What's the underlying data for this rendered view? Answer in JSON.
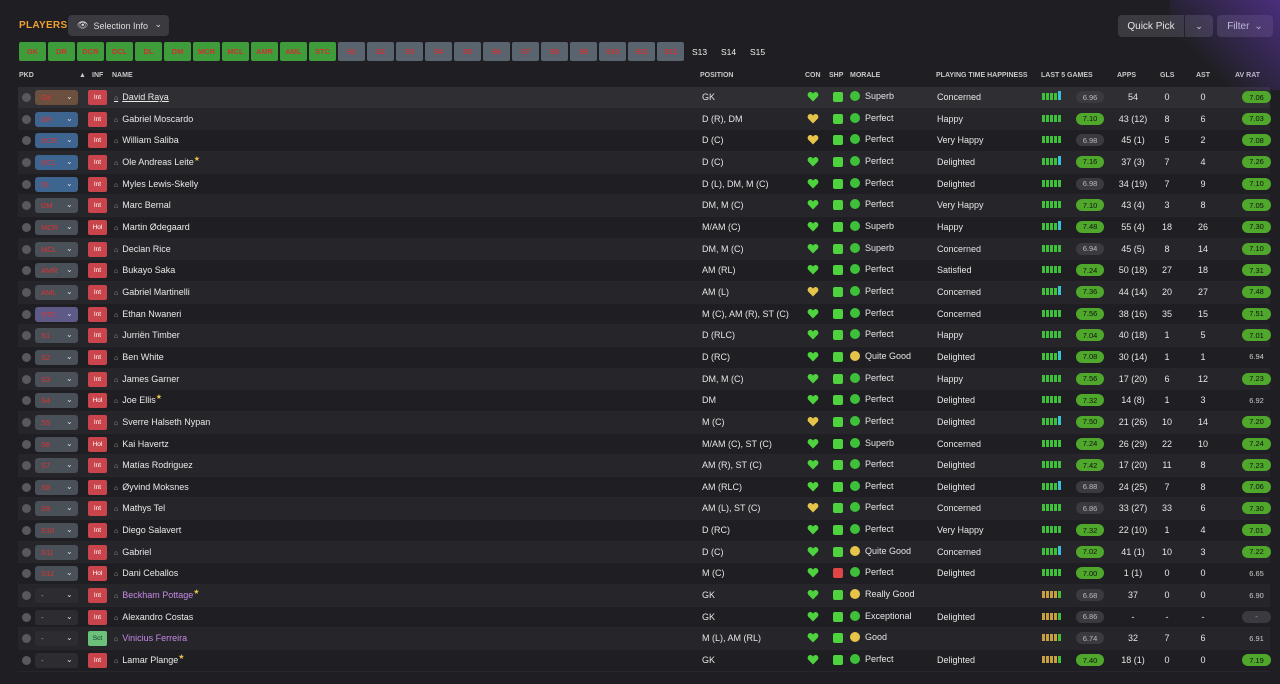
{
  "header": {
    "title": "PLAYERS",
    "selection_info": "Selection Info",
    "quick_pick": "Quick Pick",
    "filter": "Filter"
  },
  "position_buttons": [
    "GK",
    "DR",
    "DCR",
    "DCL",
    "DL",
    "DM",
    "MCR",
    "MCL",
    "AMR",
    "AML",
    "STC",
    "S1",
    "S2",
    "S3",
    "S4",
    "S5",
    "S6",
    "S7",
    "S8",
    "S9",
    "S10",
    "S11",
    "S12",
    "S13",
    "S14",
    "S15"
  ],
  "columns": {
    "pkd": "PKD",
    "inf": "INF",
    "name": "NAME",
    "position": "POSITION",
    "con": "CON",
    "shp": "SHP",
    "morale": "MORALE",
    "pth": "PLAYING TIME HAPPINESS",
    "last5": "LAST 5 GAMES",
    "apps": "APPS",
    "gls": "GLS",
    "ast": "AST",
    "avrat": "AV RAT"
  },
  "players": [
    {
      "pk": "GK",
      "inf": "Int",
      "name": "David Raya",
      "pos": "GK",
      "morale": "Superb",
      "pth": "Concerned",
      "rating": "6.96",
      "apps": "54",
      "gls": "0",
      "ast": "0",
      "av": "7.06"
    },
    {
      "pk": "DR",
      "inf": "Int",
      "name": "Gabriel Moscardo",
      "pos": "D (R), DM",
      "morale": "Perfect",
      "pth": "Happy",
      "rating": "7.10",
      "apps": "43 (12)",
      "gls": "8",
      "ast": "6",
      "av": "7.03"
    },
    {
      "pk": "DCR",
      "inf": "Int",
      "name": "William Saliba",
      "pos": "D (C)",
      "morale": "Perfect",
      "pth": "Very Happy",
      "rating": "6.98",
      "apps": "45 (1)",
      "gls": "5",
      "ast": "2",
      "av": "7.08"
    },
    {
      "pk": "DCL",
      "inf": "Int",
      "name": "Ole Andreas Leite",
      "pos": "D (C)",
      "morale": "Perfect",
      "pth": "Delighted",
      "rating": "7.16",
      "apps": "37 (3)",
      "gls": "7",
      "ast": "4",
      "av": "7.26"
    },
    {
      "pk": "DL",
      "inf": "Int",
      "name": "Myles Lewis-Skelly",
      "pos": "D (L), DM, M (C)",
      "morale": "Perfect",
      "pth": "Delighted",
      "rating": "6.98",
      "apps": "34 (19)",
      "gls": "7",
      "ast": "9",
      "av": "7.10"
    },
    {
      "pk": "DM",
      "inf": "Int",
      "name": "Marc Bernal",
      "pos": "DM, M (C)",
      "morale": "Perfect",
      "pth": "Very Happy",
      "rating": "7.10",
      "apps": "43 (4)",
      "gls": "3",
      "ast": "8",
      "av": "7.05"
    },
    {
      "pk": "MCR",
      "inf": "Hol",
      "name": "Martin Ødegaard",
      "pos": "M/AM (C)",
      "morale": "Superb",
      "pth": "Happy",
      "rating": "7.48",
      "apps": "55 (4)",
      "gls": "18",
      "ast": "26",
      "av": "7.30"
    },
    {
      "pk": "MCL",
      "inf": "Int",
      "name": "Declan Rice",
      "pos": "DM, M (C)",
      "morale": "Superb",
      "pth": "Concerned",
      "rating": "6.94",
      "apps": "45 (5)",
      "gls": "8",
      "ast": "14",
      "av": "7.10"
    },
    {
      "pk": "AMR",
      "inf": "Int",
      "name": "Bukayo Saka",
      "pos": "AM (RL)",
      "morale": "Perfect",
      "pth": "Satisfied",
      "rating": "7.24",
      "apps": "50 (18)",
      "gls": "27",
      "ast": "18",
      "av": "7.31"
    },
    {
      "pk": "AML",
      "inf": "Int",
      "name": "Gabriel Martinelli",
      "pos": "AM (L)",
      "morale": "Perfect",
      "pth": "Concerned",
      "rating": "7.36",
      "apps": "44 (14)",
      "gls": "20",
      "ast": "27",
      "av": "7.48"
    },
    {
      "pk": "STC",
      "inf": "Int",
      "name": "Ethan Nwaneri",
      "pos": "M (C), AM (R), ST (C)",
      "morale": "Perfect",
      "pth": "Concerned",
      "rating": "7.56",
      "apps": "38 (16)",
      "gls": "35",
      "ast": "15",
      "av": "7.51"
    },
    {
      "pk": "S1",
      "inf": "Int",
      "name": "Jurriën Timber",
      "pos": "D (RLC)",
      "morale": "Perfect",
      "pth": "Happy",
      "rating": "7.04",
      "apps": "40 (18)",
      "gls": "1",
      "ast": "5",
      "av": "7.01"
    },
    {
      "pk": "S2",
      "inf": "Int",
      "name": "Ben White",
      "pos": "D (RC)",
      "morale": "Quite Good",
      "pth": "Delighted",
      "rating": "7.08",
      "apps": "30 (14)",
      "gls": "1",
      "ast": "1",
      "av": "6.94"
    },
    {
      "pk": "S3",
      "inf": "Int",
      "name": "James Garner",
      "pos": "DM, M (C)",
      "morale": "Perfect",
      "pth": "Happy",
      "rating": "7.56",
      "apps": "17 (20)",
      "gls": "6",
      "ast": "12",
      "av": "7.23"
    },
    {
      "pk": "S4",
      "inf": "Hol",
      "name": "Joe Ellis",
      "pos": "DM",
      "morale": "Perfect",
      "pth": "Delighted",
      "rating": "7.32",
      "apps": "14 (8)",
      "gls": "1",
      "ast": "3",
      "av": "6.92"
    },
    {
      "pk": "S5",
      "inf": "Int",
      "name": "Sverre Halseth Nypan",
      "pos": "M (C)",
      "morale": "Perfect",
      "pth": "Delighted",
      "rating": "7.50",
      "apps": "21 (26)",
      "gls": "10",
      "ast": "14",
      "av": "7.20"
    },
    {
      "pk": "S6",
      "inf": "Hol",
      "name": "Kai Havertz",
      "pos": "M/AM (C), ST (C)",
      "morale": "Superb",
      "pth": "Concerned",
      "rating": "7.24",
      "apps": "26 (29)",
      "gls": "22",
      "ast": "10",
      "av": "7.24"
    },
    {
      "pk": "S7",
      "inf": "Int",
      "name": "Matías Rodriguez",
      "pos": "AM (R), ST (C)",
      "morale": "Perfect",
      "pth": "Delighted",
      "rating": "7.42",
      "apps": "17 (20)",
      "gls": "11",
      "ast": "8",
      "av": "7.23"
    },
    {
      "pk": "S8",
      "inf": "Int",
      "name": "Øyvind Moksnes",
      "pos": "AM (RLC)",
      "morale": "Perfect",
      "pth": "Delighted",
      "rating": "6.88",
      "apps": "24 (25)",
      "gls": "7",
      "ast": "8",
      "av": "7.06"
    },
    {
      "pk": "S9",
      "inf": "Int",
      "name": "Mathys Tel",
      "pos": "AM (L), ST (C)",
      "morale": "Perfect",
      "pth": "Concerned",
      "rating": "6.86",
      "apps": "33 (27)",
      "gls": "33",
      "ast": "6",
      "av": "7.30"
    },
    {
      "pk": "S10",
      "inf": "Int",
      "name": "Diego Salavert",
      "pos": "D (RC)",
      "morale": "Perfect",
      "pth": "Very Happy",
      "rating": "7.32",
      "apps": "22 (10)",
      "gls": "1",
      "ast": "4",
      "av": "7.01"
    },
    {
      "pk": "S11",
      "inf": "Int",
      "name": "Gabriel",
      "pos": "D (C)",
      "morale": "Quite Good",
      "pth": "Concerned",
      "rating": "7.02",
      "apps": "41 (1)",
      "gls": "10",
      "ast": "3",
      "av": "7.22"
    },
    {
      "pk": "S12",
      "inf": "Hol",
      "name": "Dani Ceballos",
      "pos": "M (C)",
      "morale": "Perfect",
      "pth": "Delighted",
      "rating": "7.00",
      "apps": "1 (1)",
      "gls": "0",
      "ast": "0",
      "av": "6.65"
    },
    {
      "pk": "-",
      "inf": "Int",
      "name": "Beckham Pottage",
      "pos": "GK",
      "morale": "Really Good",
      "pth": "",
      "rating": "6.68",
      "apps": "37",
      "gls": "0",
      "ast": "0",
      "av": "6.90"
    },
    {
      "pk": "-",
      "inf": "Int",
      "name": "Alexandro Costas",
      "pos": "GK",
      "morale": "Exceptional",
      "pth": "Delighted",
      "rating": "6.86",
      "apps": "-",
      "gls": "-",
      "ast": "-",
      "av": "-"
    },
    {
      "pk": "-",
      "inf": "Sct",
      "name": "Vinicius Ferreira",
      "pos": "M (L), AM (RL)",
      "morale": "Good",
      "pth": "",
      "rating": "6.74",
      "apps": "32",
      "gls": "7",
      "ast": "6",
      "av": "6.91"
    },
    {
      "pk": "-",
      "inf": "Int",
      "name": "Lamar Plange",
      "pos": "GK",
      "morale": "Perfect",
      "pth": "Delighted",
      "rating": "7.40",
      "apps": "18 (1)",
      "gls": "0",
      "ast": "0",
      "av": "7.19"
    }
  ]
}
